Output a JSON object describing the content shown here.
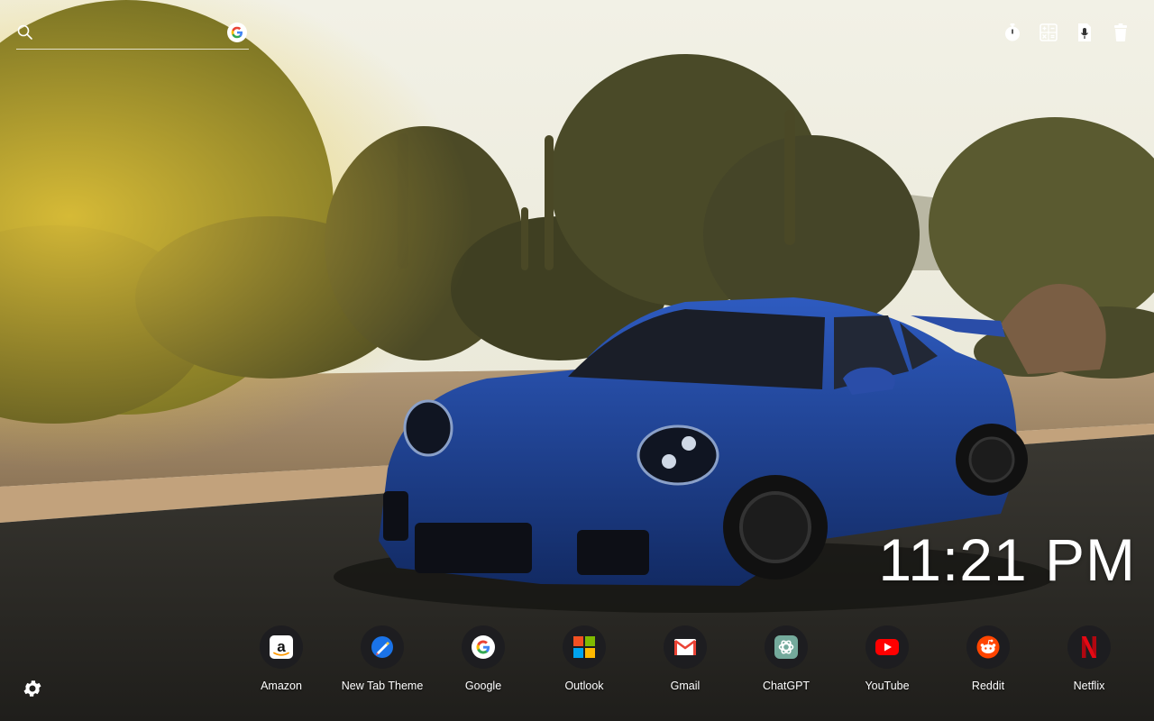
{
  "search": {
    "placeholder": ""
  },
  "background": {
    "description_icon": "car-wallpaper",
    "car_color": "#1c3f8f",
    "sky_color": "#eeeede"
  },
  "toolbar": {
    "icons": [
      "timer-icon",
      "calculator-icon",
      "dictation-icon",
      "trash-icon"
    ]
  },
  "clock": {
    "time": "11:21 PM"
  },
  "shortcuts": [
    {
      "label": "Amazon",
      "icon": "amazon-icon"
    },
    {
      "label": "New Tab Theme",
      "icon": "new-tab-theme-icon"
    },
    {
      "label": "Google",
      "icon": "google-icon"
    },
    {
      "label": "Outlook",
      "icon": "outlook-icon"
    },
    {
      "label": "Gmail",
      "icon": "gmail-icon"
    },
    {
      "label": "ChatGPT",
      "icon": "chatgpt-icon"
    },
    {
      "label": "YouTube",
      "icon": "youtube-icon"
    },
    {
      "label": "Reddit",
      "icon": "reddit-icon"
    },
    {
      "label": "Netflix",
      "icon": "netflix-icon"
    }
  ],
  "colors": {
    "text": "#ffffff",
    "shortcut_bg": "#1c1c20",
    "youtube": "#ff0000",
    "reddit": "#ff4500",
    "netflix": "#e50914"
  }
}
